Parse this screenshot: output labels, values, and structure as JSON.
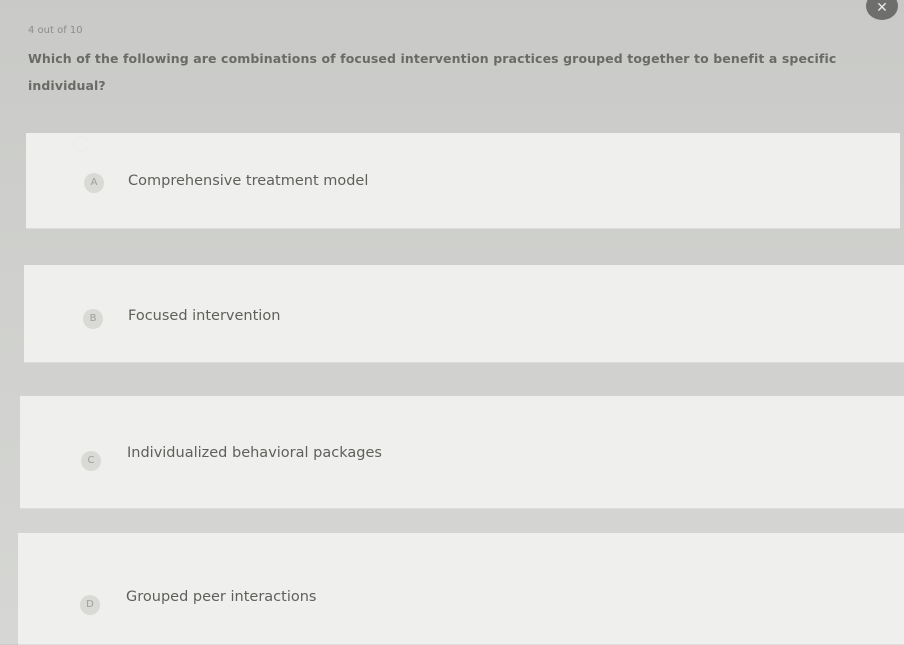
{
  "quiz": {
    "progress": "4 out of 10",
    "question": "Which of the following are combinations of focused intervention practices grouped together to benefit a specific individual?",
    "close_icon": "close-x-icon",
    "options": [
      {
        "letter": "A",
        "label": "Comprehensive treatment model"
      },
      {
        "letter": "B",
        "label": "Focused intervention"
      },
      {
        "letter": "C",
        "label": "Individualized behavioral packages"
      },
      {
        "letter": "D",
        "label": "Grouped peer interactions"
      }
    ]
  }
}
